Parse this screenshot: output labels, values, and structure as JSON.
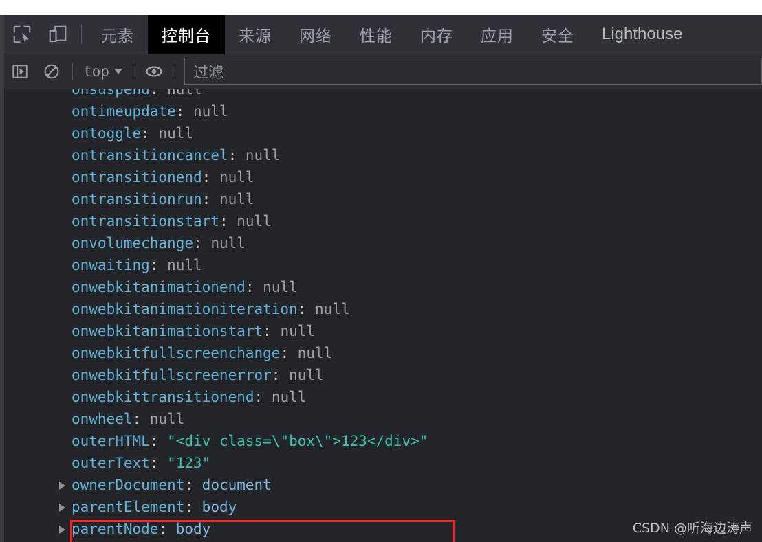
{
  "window": {
    "background": "#242529",
    "accent_red": "#ff1c1c"
  },
  "tabbar": {
    "icons": [
      {
        "name": "inspect-element-icon",
        "title": "检查元素"
      },
      {
        "name": "device-toolbar-icon",
        "title": "设备工具栏"
      }
    ],
    "tabs": [
      {
        "label": "元素",
        "active": false
      },
      {
        "label": "控制台",
        "active": true
      },
      {
        "label": "来源",
        "active": false
      },
      {
        "label": "网络",
        "active": false
      },
      {
        "label": "性能",
        "active": false
      },
      {
        "label": "内存",
        "active": false
      },
      {
        "label": "应用",
        "active": false
      },
      {
        "label": "安全",
        "active": false
      },
      {
        "label": "Lighthouse",
        "active": false
      }
    ]
  },
  "consolebar": {
    "sidebar_toggle_icon": "console-sidebar-icon",
    "clear_icon": "clear-console-icon",
    "context_value": "top",
    "eye_icon": "live-expression-eye-icon",
    "filter_placeholder": "过滤"
  },
  "console": {
    "lines": [
      {
        "key": "onsuspend",
        "value": "null",
        "vtype": "null",
        "expandable": false,
        "clipped": true
      },
      {
        "key": "ontimeupdate",
        "value": "null",
        "vtype": "null",
        "expandable": false
      },
      {
        "key": "ontoggle",
        "value": "null",
        "vtype": "null",
        "expandable": false
      },
      {
        "key": "ontransitioncancel",
        "value": "null",
        "vtype": "null",
        "expandable": false
      },
      {
        "key": "ontransitionend",
        "value": "null",
        "vtype": "null",
        "expandable": false
      },
      {
        "key": "ontransitionrun",
        "value": "null",
        "vtype": "null",
        "expandable": false
      },
      {
        "key": "ontransitionstart",
        "value": "null",
        "vtype": "null",
        "expandable": false
      },
      {
        "key": "onvolumechange",
        "value": "null",
        "vtype": "null",
        "expandable": false
      },
      {
        "key": "onwaiting",
        "value": "null",
        "vtype": "null",
        "expandable": false
      },
      {
        "key": "onwebkitanimationend",
        "value": "null",
        "vtype": "null",
        "expandable": false
      },
      {
        "key": "onwebkitanimationiteration",
        "value": "null",
        "vtype": "null",
        "expandable": false
      },
      {
        "key": "onwebkitanimationstart",
        "value": "null",
        "vtype": "null",
        "expandable": false
      },
      {
        "key": "onwebkitfullscreenchange",
        "value": "null",
        "vtype": "null",
        "expandable": false
      },
      {
        "key": "onwebkitfullscreenerror",
        "value": "null",
        "vtype": "null",
        "expandable": false
      },
      {
        "key": "onwebkittransitionend",
        "value": "null",
        "vtype": "null",
        "expandable": false
      },
      {
        "key": "onwheel",
        "value": "null",
        "vtype": "null",
        "expandable": false
      },
      {
        "key": "outerHTML",
        "value": "\"<div class=\\\"box\\\">123</div>\"",
        "vtype": "string",
        "expandable": false,
        "highlighted": true
      },
      {
        "key": "outerText",
        "value": "\"123\"",
        "vtype": "string",
        "expandable": false
      },
      {
        "key": "ownerDocument",
        "value": "document",
        "vtype": "node",
        "expandable": true
      },
      {
        "key": "parentElement",
        "value": "body",
        "vtype": "node",
        "expandable": true
      },
      {
        "key": "parentNode",
        "value": "body",
        "vtype": "node",
        "expandable": true
      }
    ]
  },
  "watermark": {
    "text": "CSDN @听海边涛声"
  }
}
